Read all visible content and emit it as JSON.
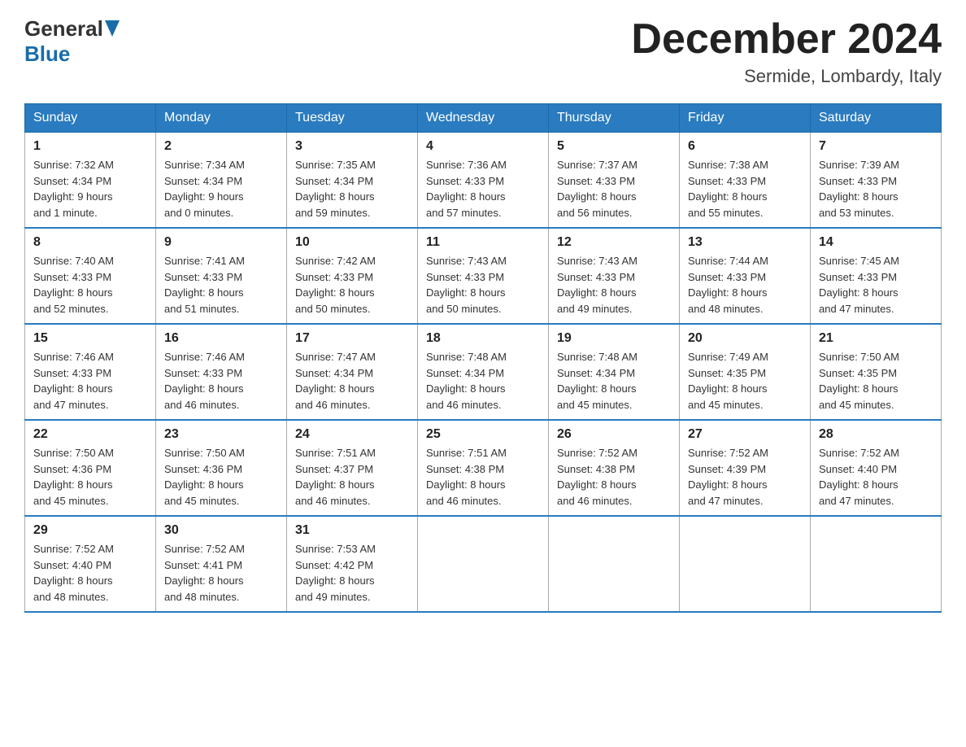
{
  "header": {
    "logo_general": "General",
    "logo_blue": "Blue",
    "month_title": "December 2024",
    "location": "Sermide, Lombardy, Italy"
  },
  "days_of_week": [
    "Sunday",
    "Monday",
    "Tuesday",
    "Wednesday",
    "Thursday",
    "Friday",
    "Saturday"
  ],
  "weeks": [
    [
      {
        "day": "1",
        "sunrise": "7:32 AM",
        "sunset": "4:34 PM",
        "daylight": "9 hours and 1 minute."
      },
      {
        "day": "2",
        "sunrise": "7:34 AM",
        "sunset": "4:34 PM",
        "daylight": "9 hours and 0 minutes."
      },
      {
        "day": "3",
        "sunrise": "7:35 AM",
        "sunset": "4:34 PM",
        "daylight": "8 hours and 59 minutes."
      },
      {
        "day": "4",
        "sunrise": "7:36 AM",
        "sunset": "4:33 PM",
        "daylight": "8 hours and 57 minutes."
      },
      {
        "day": "5",
        "sunrise": "7:37 AM",
        "sunset": "4:33 PM",
        "daylight": "8 hours and 56 minutes."
      },
      {
        "day": "6",
        "sunrise": "7:38 AM",
        "sunset": "4:33 PM",
        "daylight": "8 hours and 55 minutes."
      },
      {
        "day": "7",
        "sunrise": "7:39 AM",
        "sunset": "4:33 PM",
        "daylight": "8 hours and 53 minutes."
      }
    ],
    [
      {
        "day": "8",
        "sunrise": "7:40 AM",
        "sunset": "4:33 PM",
        "daylight": "8 hours and 52 minutes."
      },
      {
        "day": "9",
        "sunrise": "7:41 AM",
        "sunset": "4:33 PM",
        "daylight": "8 hours and 51 minutes."
      },
      {
        "day": "10",
        "sunrise": "7:42 AM",
        "sunset": "4:33 PM",
        "daylight": "8 hours and 50 minutes."
      },
      {
        "day": "11",
        "sunrise": "7:43 AM",
        "sunset": "4:33 PM",
        "daylight": "8 hours and 50 minutes."
      },
      {
        "day": "12",
        "sunrise": "7:43 AM",
        "sunset": "4:33 PM",
        "daylight": "8 hours and 49 minutes."
      },
      {
        "day": "13",
        "sunrise": "7:44 AM",
        "sunset": "4:33 PM",
        "daylight": "8 hours and 48 minutes."
      },
      {
        "day": "14",
        "sunrise": "7:45 AM",
        "sunset": "4:33 PM",
        "daylight": "8 hours and 47 minutes."
      }
    ],
    [
      {
        "day": "15",
        "sunrise": "7:46 AM",
        "sunset": "4:33 PM",
        "daylight": "8 hours and 47 minutes."
      },
      {
        "day": "16",
        "sunrise": "7:46 AM",
        "sunset": "4:33 PM",
        "daylight": "8 hours and 46 minutes."
      },
      {
        "day": "17",
        "sunrise": "7:47 AM",
        "sunset": "4:34 PM",
        "daylight": "8 hours and 46 minutes."
      },
      {
        "day": "18",
        "sunrise": "7:48 AM",
        "sunset": "4:34 PM",
        "daylight": "8 hours and 46 minutes."
      },
      {
        "day": "19",
        "sunrise": "7:48 AM",
        "sunset": "4:34 PM",
        "daylight": "8 hours and 45 minutes."
      },
      {
        "day": "20",
        "sunrise": "7:49 AM",
        "sunset": "4:35 PM",
        "daylight": "8 hours and 45 minutes."
      },
      {
        "day": "21",
        "sunrise": "7:50 AM",
        "sunset": "4:35 PM",
        "daylight": "8 hours and 45 minutes."
      }
    ],
    [
      {
        "day": "22",
        "sunrise": "7:50 AM",
        "sunset": "4:36 PM",
        "daylight": "8 hours and 45 minutes."
      },
      {
        "day": "23",
        "sunrise": "7:50 AM",
        "sunset": "4:36 PM",
        "daylight": "8 hours and 45 minutes."
      },
      {
        "day": "24",
        "sunrise": "7:51 AM",
        "sunset": "4:37 PM",
        "daylight": "8 hours and 46 minutes."
      },
      {
        "day": "25",
        "sunrise": "7:51 AM",
        "sunset": "4:38 PM",
        "daylight": "8 hours and 46 minutes."
      },
      {
        "day": "26",
        "sunrise": "7:52 AM",
        "sunset": "4:38 PM",
        "daylight": "8 hours and 46 minutes."
      },
      {
        "day": "27",
        "sunrise": "7:52 AM",
        "sunset": "4:39 PM",
        "daylight": "8 hours and 47 minutes."
      },
      {
        "day": "28",
        "sunrise": "7:52 AM",
        "sunset": "4:40 PM",
        "daylight": "8 hours and 47 minutes."
      }
    ],
    [
      {
        "day": "29",
        "sunrise": "7:52 AM",
        "sunset": "4:40 PM",
        "daylight": "8 hours and 48 minutes."
      },
      {
        "day": "30",
        "sunrise": "7:52 AM",
        "sunset": "4:41 PM",
        "daylight": "8 hours and 48 minutes."
      },
      {
        "day": "31",
        "sunrise": "7:53 AM",
        "sunset": "4:42 PM",
        "daylight": "8 hours and 49 minutes."
      },
      null,
      null,
      null,
      null
    ]
  ],
  "labels": {
    "sunrise": "Sunrise:",
    "sunset": "Sunset:",
    "daylight": "Daylight:"
  }
}
